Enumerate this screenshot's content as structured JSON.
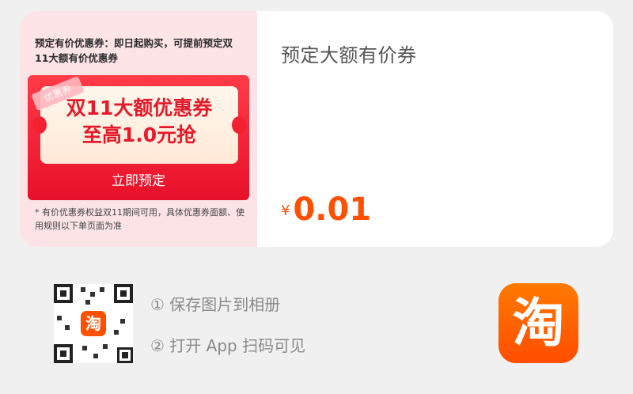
{
  "card": {
    "cover": {
      "note": "预定有价优惠券：即日起购买，可提前预定双11大额有价优惠券",
      "coupon": {
        "tag": "优惠券",
        "line1": "双11大额优惠券",
        "line2": "至高1.0元抢",
        "button": "立即预定"
      },
      "disclaimer": "* 有价优惠券权益双11期间可用，具体优惠券面额、使用规则以下单页面为准"
    },
    "title": "预定大额有价券",
    "price": {
      "symbol": "¥",
      "value": "0.01"
    }
  },
  "share": {
    "qr_logo": "淘",
    "step1": "① 保存图片到相册",
    "step2": "② 打开 App 扫码可见",
    "app_icon": "淘"
  },
  "colors": {
    "accent": "#ff4f00",
    "coupon_red": "#e8102a",
    "background": "#f0f0f0"
  },
  "icons": [
    "qr-code-icon",
    "taobao-app-icon"
  ]
}
